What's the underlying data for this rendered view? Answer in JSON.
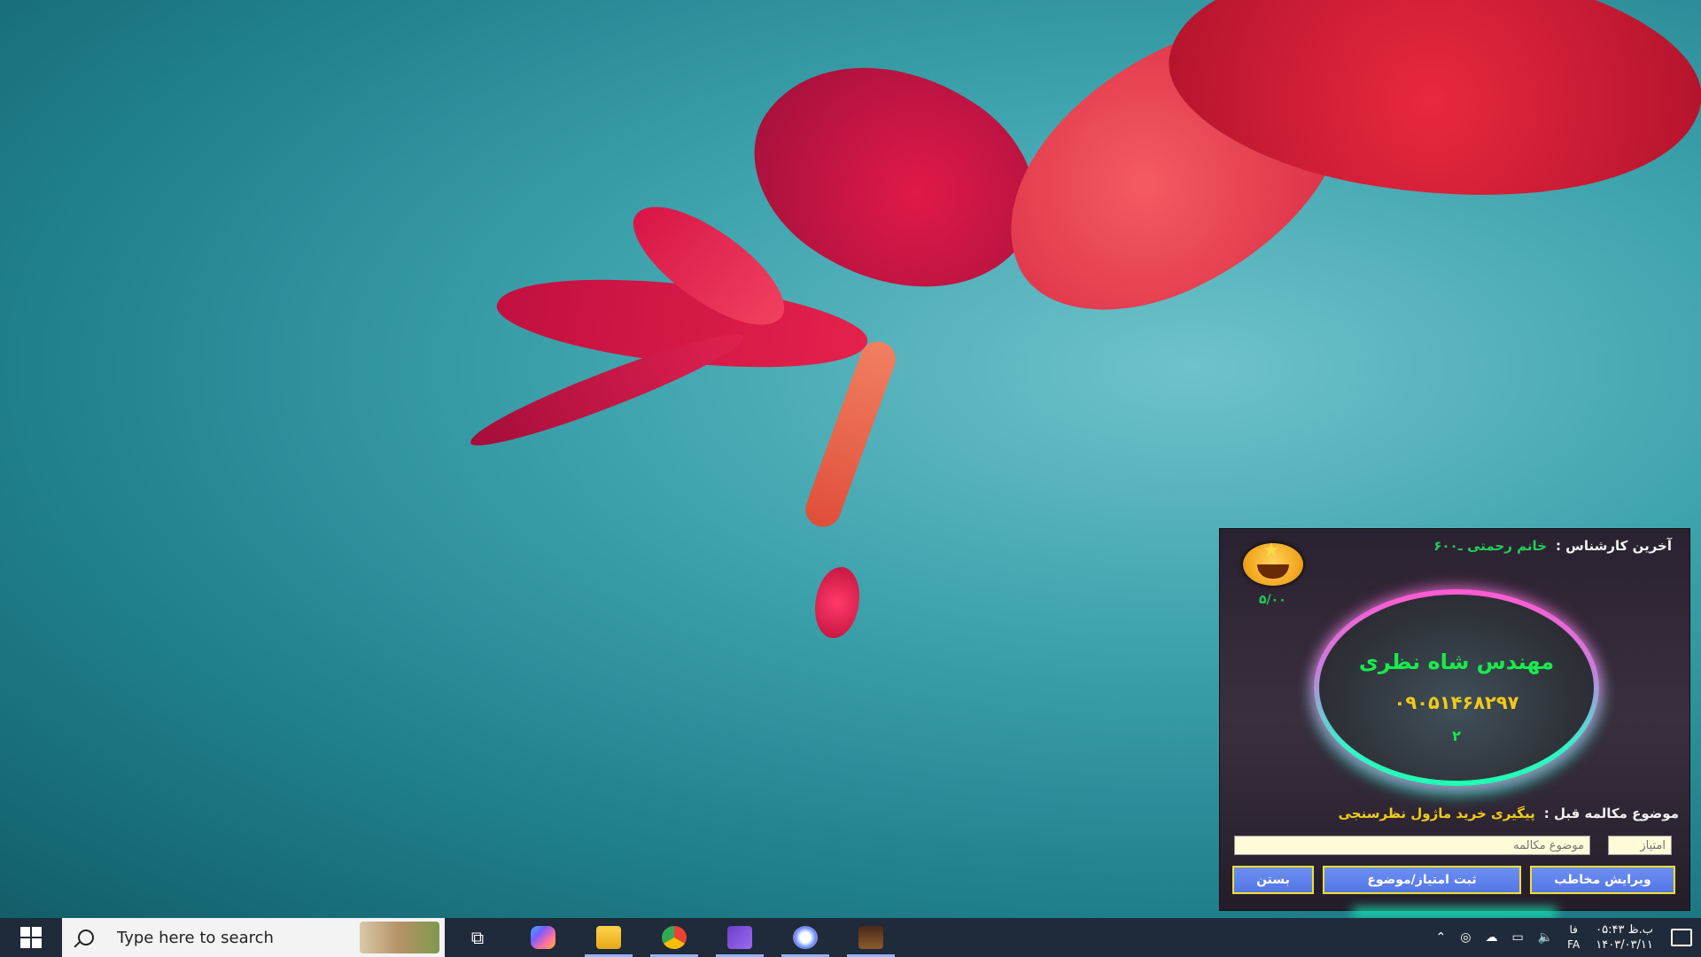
{
  "popup": {
    "last_expert_label": "آخرین کارشناس :",
    "last_expert_value": "خانم رحمتی ـ۶۰۰",
    "score": "۵/۰۰",
    "contact_name": "مهندس شاه نظری",
    "contact_phone": "۰۹۰۵۱۴۶۸۲۹۷",
    "contact_count": "۲",
    "prev_topic_label": "موضوع مکالمه قبل :",
    "prev_topic_value": "پیگیری خرید ماژول نظرسنجی",
    "topic_placeholder": "موضوع مکالمه",
    "score_placeholder": "امتیاز",
    "btn_close": "بستن",
    "btn_save": "ثبت امتیاز/موضوع",
    "btn_edit": "ویرایش مخاطب"
  },
  "taskbar": {
    "search_placeholder": "Type here to search",
    "lang_top": "فا",
    "lang_bottom": "FA",
    "time": "ب.ظ ۰۵:۴۳",
    "date": "۱۴۰۳/۰۳/۱۱",
    "apps": [
      "task-view",
      "copilot",
      "file-explorer",
      "chrome",
      "visual-studio",
      "paint",
      "app-game"
    ]
  },
  "colors": {
    "desktop_bg": "#3ea3ad",
    "accent_green": "#19ea4d",
    "accent_yellow": "#f3c81a",
    "button_blue": "#5476e6",
    "taskbar_bg": "#1f2a3a"
  }
}
